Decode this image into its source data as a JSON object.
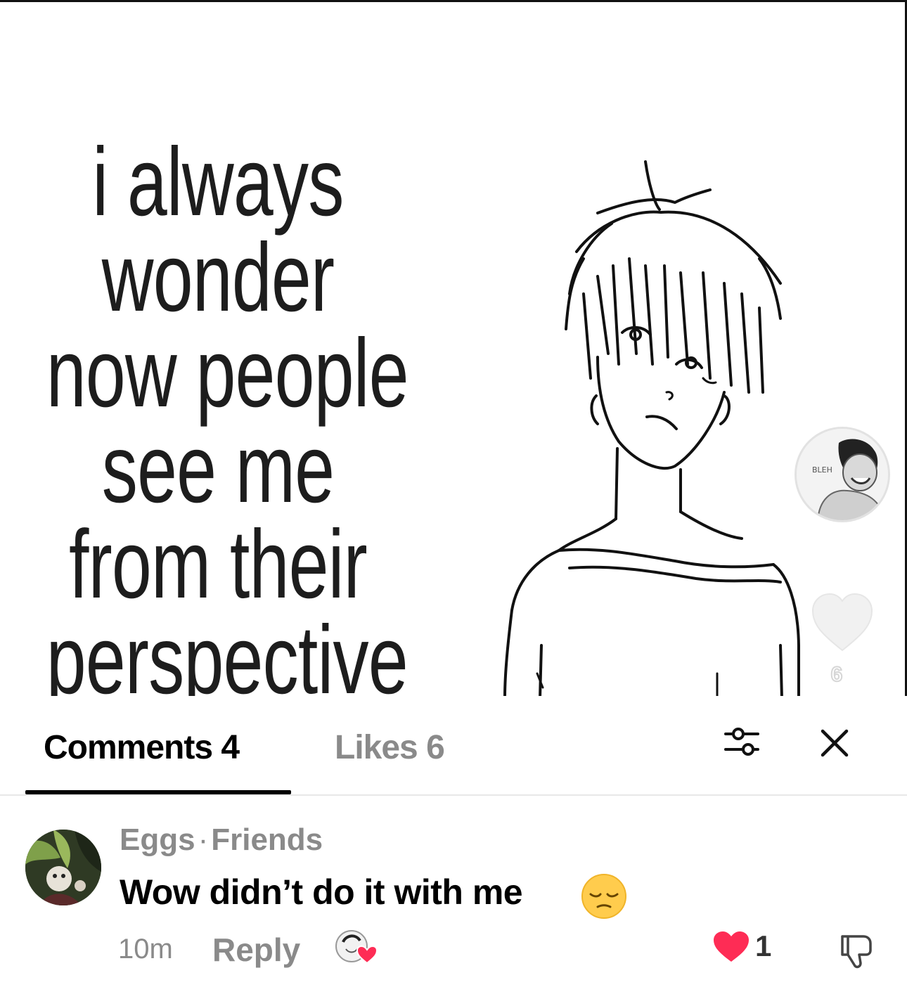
{
  "post": {
    "meme_lines": [
      "i always",
      "wonder",
      "now people",
      "see me",
      "from their",
      "perspective"
    ],
    "avatar_sticker_text": "BLEH",
    "like_count": "6"
  },
  "sheet": {
    "tabs": [
      {
        "label": "Comments 4",
        "active": true
      },
      {
        "label": "Likes 6",
        "active": false
      }
    ],
    "icons": {
      "filter": "sliders-icon",
      "close": "close-icon"
    }
  },
  "comment": {
    "username": "Eggs",
    "separator": "·",
    "relation": "Friends",
    "text": "Wow didn’t do it with me",
    "emoji": "pensive-face",
    "time": "10m",
    "reply_label": "Reply",
    "like_count": "1",
    "liked": true,
    "like_color": "#fe2c55"
  }
}
